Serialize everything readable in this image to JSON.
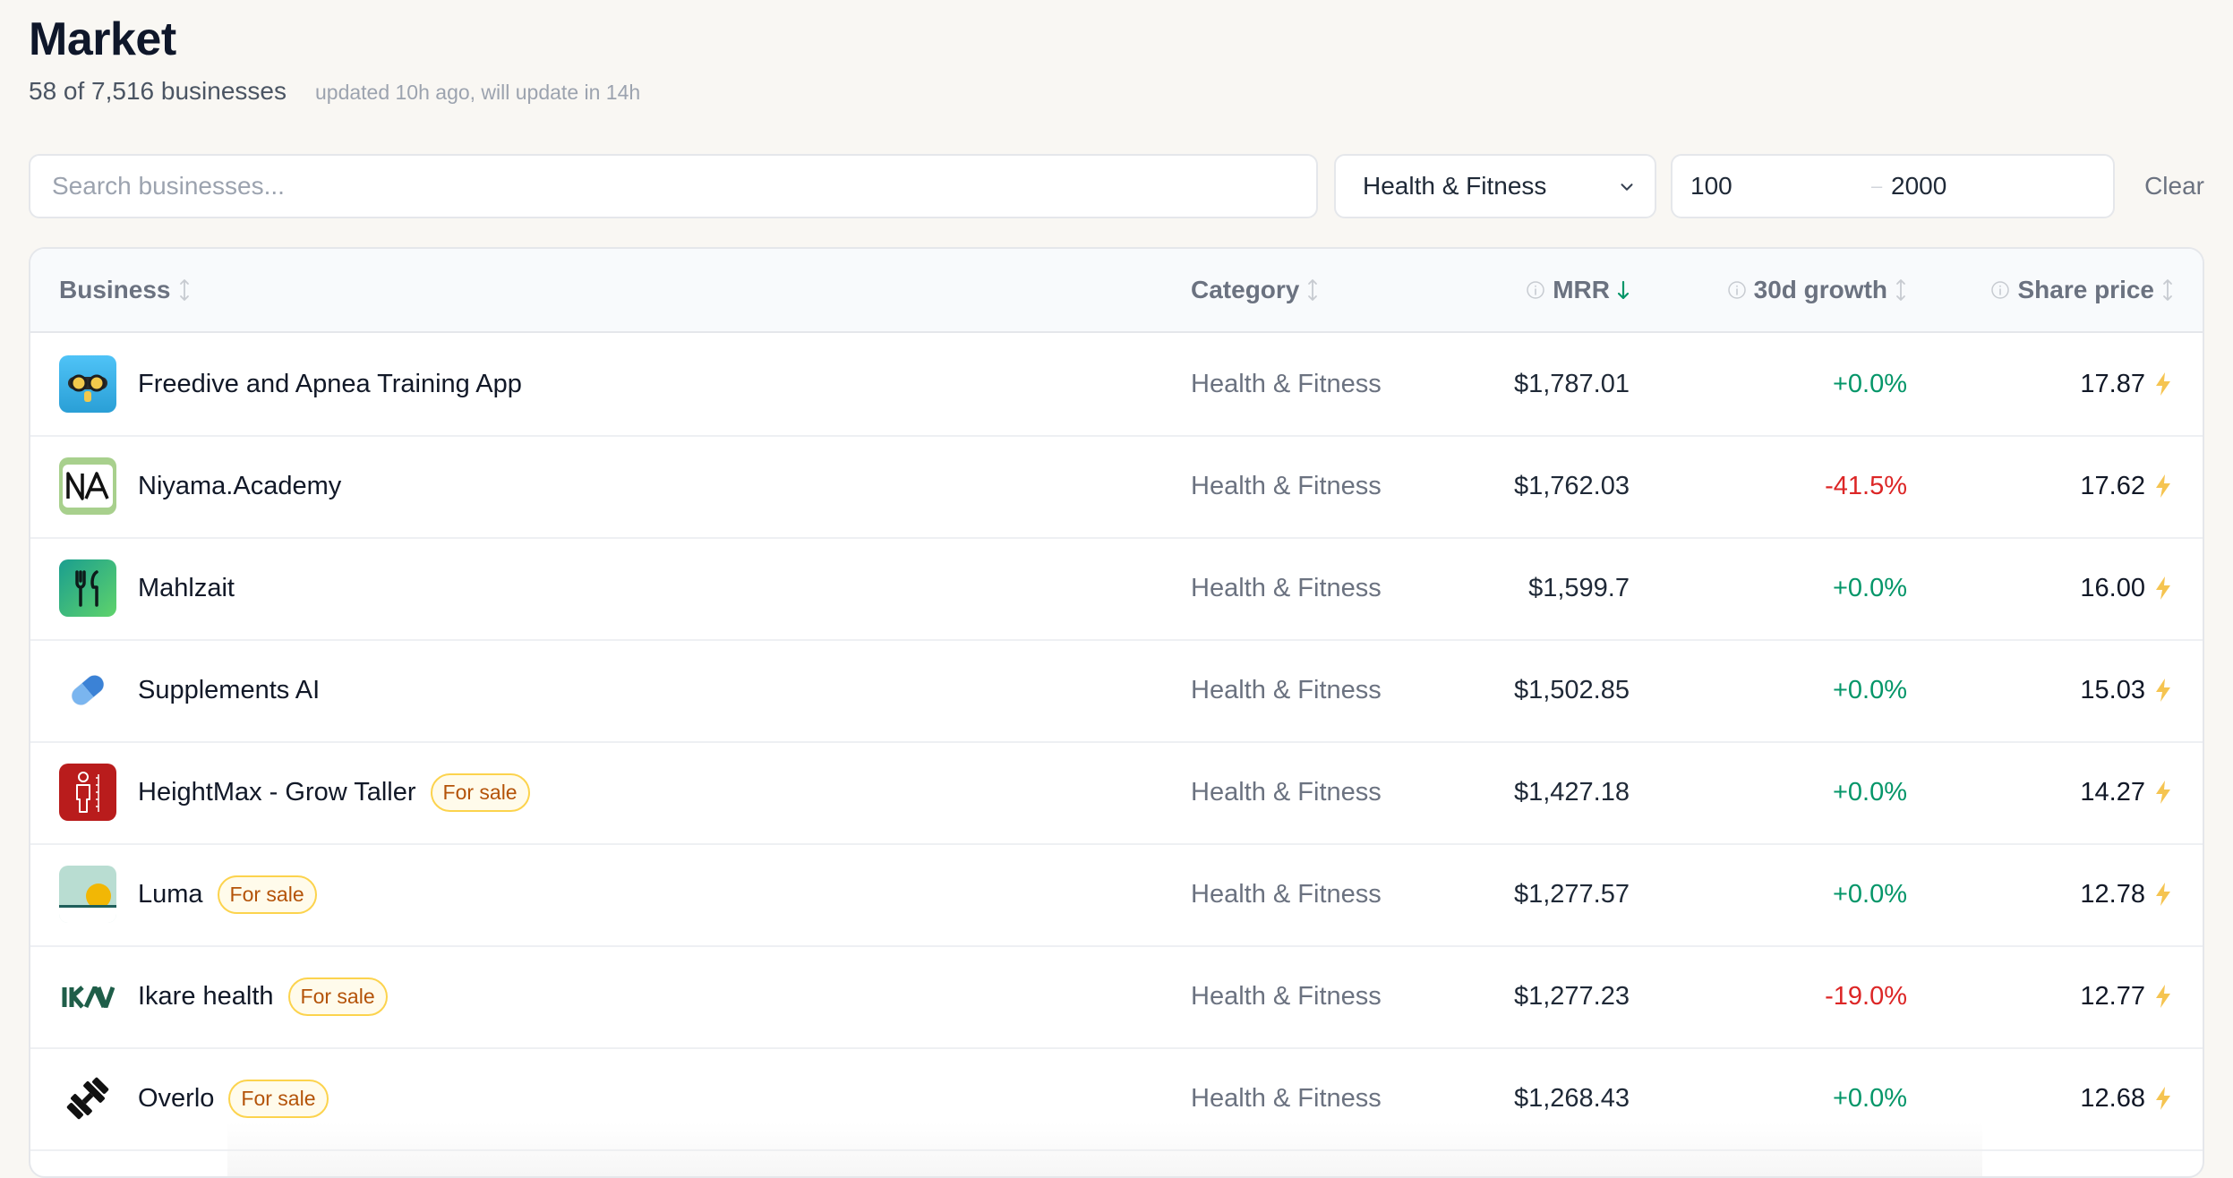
{
  "header": {
    "title": "Market",
    "count": "58 of 7,516 businesses",
    "updated": "updated 10h ago, will update in 14h"
  },
  "filters": {
    "search_placeholder": "Search businesses...",
    "search_value": "",
    "category_selected": "Health & Fitness",
    "mrr_min": "100",
    "mrr_max": "2000",
    "clear_label": "Clear"
  },
  "table": {
    "columns": {
      "business": "Business",
      "category": "Category",
      "mrr": "MRR",
      "growth": "30d growth",
      "price": "Share price"
    },
    "sort": {
      "column": "mrr",
      "direction": "desc"
    },
    "rows": [
      {
        "name": "Freedive and Apnea Training App",
        "category": "Health & Fitness",
        "mrr": "$1,787.01",
        "growth": "+0.0%",
        "growth_dir": "pos",
        "price": "17.87",
        "for_sale": false,
        "logo": "freedive-logo-icon"
      },
      {
        "name": "Niyama.Academy",
        "category": "Health & Fitness",
        "mrr": "$1,762.03",
        "growth": "-41.5%",
        "growth_dir": "neg",
        "price": "17.62",
        "for_sale": false,
        "logo": "niyama-logo-icon"
      },
      {
        "name": "Mahlzait",
        "category": "Health & Fitness",
        "mrr": "$1,599.7",
        "growth": "+0.0%",
        "growth_dir": "pos",
        "price": "16.00",
        "for_sale": false,
        "logo": "mahlzait-logo-icon"
      },
      {
        "name": "Supplements AI",
        "category": "Health & Fitness",
        "mrr": "$1,502.85",
        "growth": "+0.0%",
        "growth_dir": "pos",
        "price": "15.03",
        "for_sale": false,
        "logo": "supplements-logo-icon"
      },
      {
        "name": "HeightMax - Grow Taller",
        "category": "Health & Fitness",
        "mrr": "$1,427.18",
        "growth": "+0.0%",
        "growth_dir": "pos",
        "price": "14.27",
        "for_sale": true,
        "logo": "heightmax-logo-icon"
      },
      {
        "name": "Luma",
        "category": "Health & Fitness",
        "mrr": "$1,277.57",
        "growth": "+0.0%",
        "growth_dir": "pos",
        "price": "12.78",
        "for_sale": true,
        "logo": "luma-logo-icon"
      },
      {
        "name": "Ikare health",
        "category": "Health & Fitness",
        "mrr": "$1,277.23",
        "growth": "-19.0%",
        "growth_dir": "neg",
        "price": "12.77",
        "for_sale": true,
        "logo": "ikare-logo-icon"
      },
      {
        "name": "Overlo",
        "category": "Health & Fitness",
        "mrr": "$1,268.43",
        "growth": "+0.0%",
        "growth_dir": "pos",
        "price": "12.68",
        "for_sale": true,
        "logo": "overlo-logo-icon"
      }
    ],
    "badge_label": "For sale"
  },
  "colors": {
    "background": "#f9f7f3",
    "positive": "#059669",
    "negative": "#dc2626",
    "sort_active": "#059669",
    "badge_text": "#b45309",
    "badge_border": "#fcd34d",
    "bolt": "#f5c451"
  }
}
